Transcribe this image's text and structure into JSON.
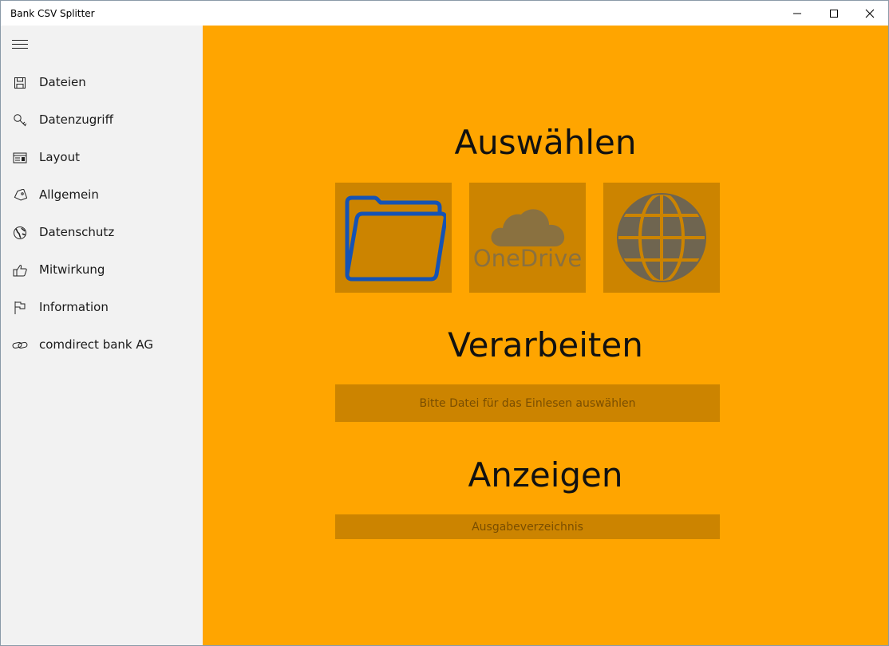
{
  "window": {
    "title": "Bank CSV Splitter"
  },
  "sidebar": {
    "items": [
      {
        "label": "Dateien",
        "icon": "save-icon"
      },
      {
        "label": "Datenzugriff",
        "icon": "key-icon"
      },
      {
        "label": "Layout",
        "icon": "layout-icon"
      },
      {
        "label": "Allgemein",
        "icon": "tag-icon"
      },
      {
        "label": "Datenschutz",
        "icon": "globe-icon"
      },
      {
        "label": "Mitwirkung",
        "icon": "thumbs-up-icon"
      },
      {
        "label": "Information",
        "icon": "flag-icon"
      },
      {
        "label": "comdirect bank AG",
        "icon": "link-icon"
      }
    ]
  },
  "main": {
    "select_heading": "Auswählen",
    "sources": [
      {
        "icon": "folder-icon"
      },
      {
        "icon": "onedrive-icon",
        "label": "OneDrive"
      },
      {
        "icon": "web-globe-icon"
      }
    ],
    "process_heading": "Verarbeiten",
    "process_button": "Bitte Datei für das Einlesen auswählen",
    "show_heading": "Anzeigen",
    "output_button": "Ausgabeverzeichnis"
  },
  "colors": {
    "accent": "#ffa500",
    "tile": "#cc8400",
    "folder_stroke": "#1553b4",
    "sidebar_bg": "#f2f2f2"
  }
}
